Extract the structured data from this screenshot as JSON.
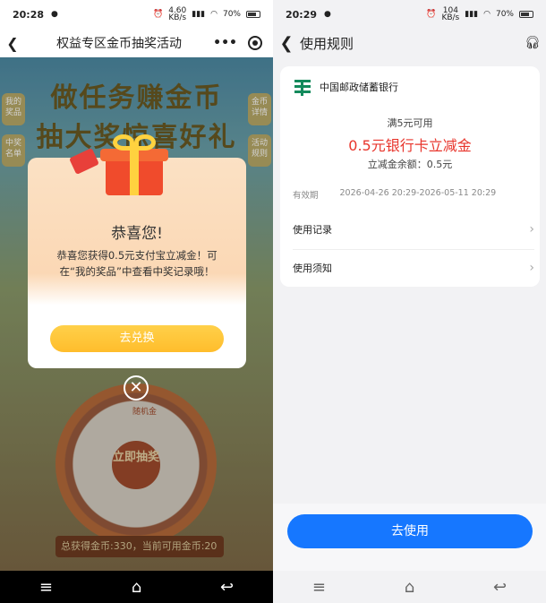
{
  "left": {
    "status": {
      "time": "20:28",
      "speed_top": "4.60",
      "speed_bottom": "KB/s",
      "battery": "70%"
    },
    "nav": {
      "title": "权益专区金币抽奖活动"
    },
    "banner": {
      "line1": "做任务赚金币",
      "line2": "抽大奖惊喜好礼"
    },
    "side_tags": {
      "my_prizes": "我的奖品",
      "winners": "中奖名单",
      "coin_details": "金币详情",
      "rules": "活动规则"
    },
    "wheel": {
      "center": "立即抽奖",
      "prize_label": "随机金"
    },
    "bottom_strip": "总获得金币:330，当前可用金币:20",
    "modal": {
      "title": "恭喜您!",
      "text": "恭喜您获得0.5元支付宝立减金！可在“我的奖品”中查看中奖记录哦！",
      "button": "去兑换"
    }
  },
  "right": {
    "status": {
      "time": "20:29",
      "speed_top": "104",
      "speed_bottom": "KB/s",
      "battery": "70%"
    },
    "nav": {
      "title": "使用规则"
    },
    "bank": "中国邮政储蓄银行",
    "condition": "满5元可用",
    "amount": "0.5元银行卡立减金",
    "balance": "立减金余额：0.5元",
    "validity_label": "有效期",
    "validity_value": "2026-04-26 20:29-2026-05-11 20:29",
    "rows": [
      {
        "label": "使用记录"
      },
      {
        "label": "使用须知"
      }
    ],
    "button": "去使用"
  },
  "colors": {
    "accent_blue": "#1677ff",
    "amount_red": "#e8352c",
    "modal_btn": "#ffc235"
  }
}
